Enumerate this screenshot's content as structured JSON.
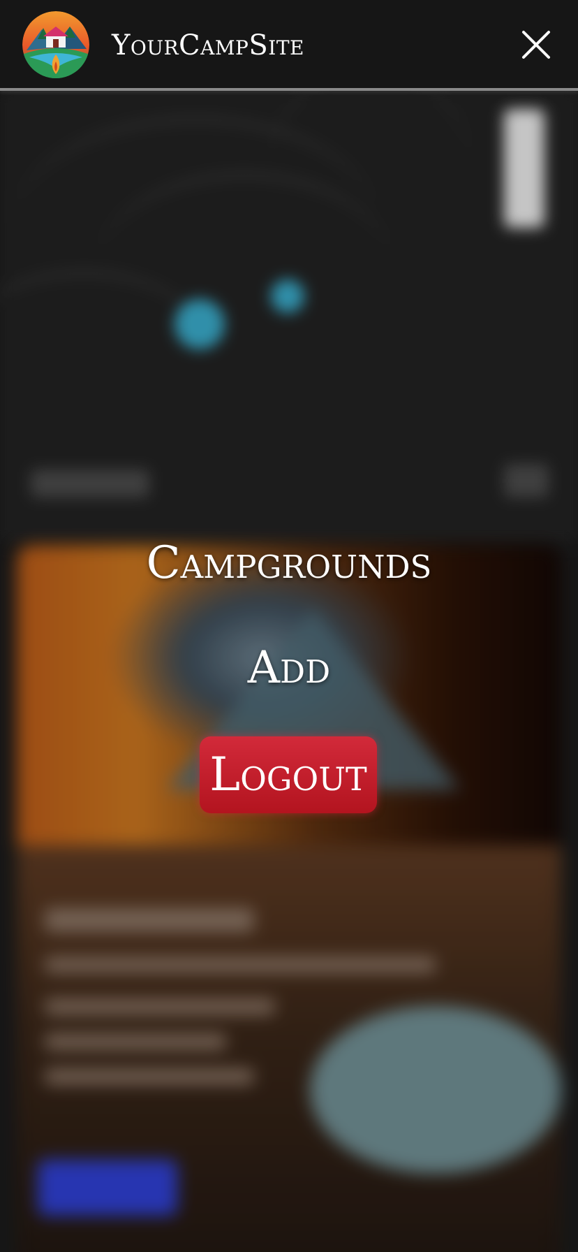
{
  "header": {
    "brand": "YourCampSite",
    "logo_icon": "campsite-logo-icon",
    "close_icon": "close-icon"
  },
  "menu": {
    "items": [
      {
        "label": "Campgrounds"
      },
      {
        "label": "Add"
      }
    ],
    "logout_label": "Logout"
  },
  "colors": {
    "header_bg": "#161616",
    "logout_red": "#c21f2c",
    "map_marker": "#39a9c8",
    "card_button_blue": "#2e3fd0"
  }
}
